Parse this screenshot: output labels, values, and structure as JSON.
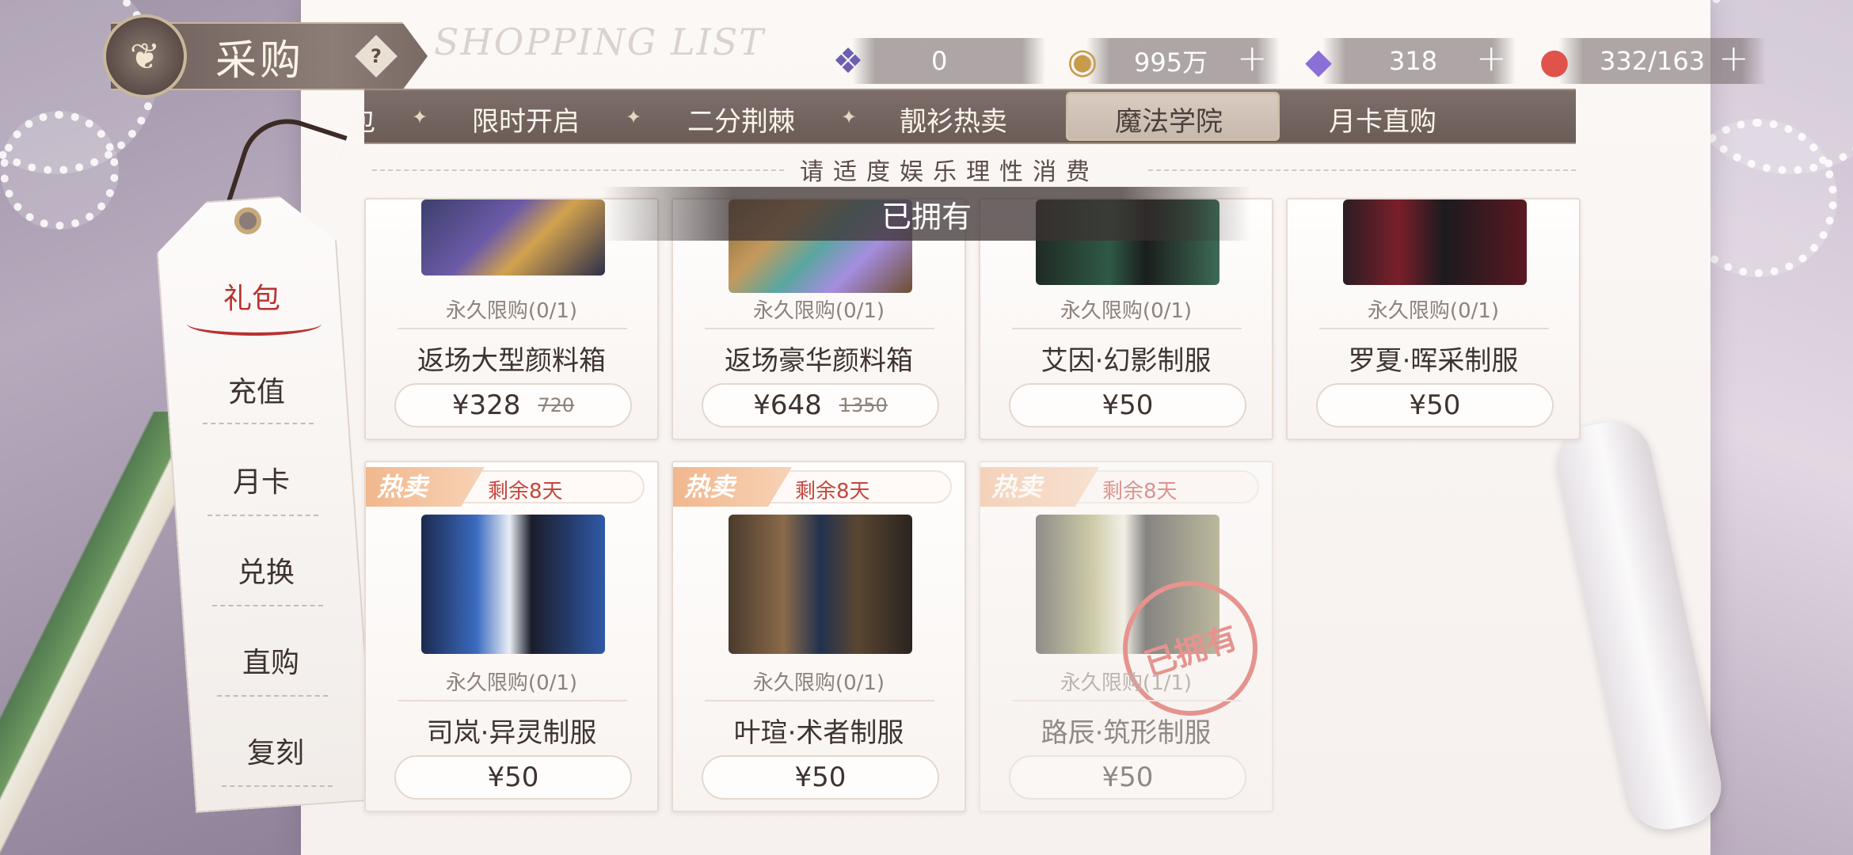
{
  "header": {
    "title": "采购",
    "help": "?",
    "watermark": "SHOPPING LIST"
  },
  "currencies": [
    {
      "icon": "ticket-icon",
      "value": "0"
    },
    {
      "icon": "coin-icon",
      "value": "995万"
    },
    {
      "icon": "diamond-icon",
      "value": "318"
    },
    {
      "icon": "cake-stamina-icon",
      "value": "332/163"
    }
  ],
  "plus_label": "+",
  "tabs": [
    {
      "label": "包",
      "active": false
    },
    {
      "label": "限时开启",
      "active": false
    },
    {
      "label": "二分荆棘",
      "active": false
    },
    {
      "label": "靓衫热卖",
      "active": false
    },
    {
      "label": "魔法学院",
      "active": true
    },
    {
      "label": "月卡直购",
      "active": false
    }
  ],
  "notice": "请适度娱乐理性消费",
  "owned_banner": "已拥有",
  "nav": [
    {
      "label": "礼包",
      "active": true
    },
    {
      "label": "充值",
      "active": false
    },
    {
      "label": "月卡",
      "active": false
    },
    {
      "label": "兑换",
      "active": false
    },
    {
      "label": "直购",
      "active": false
    },
    {
      "label": "复刻",
      "active": false
    }
  ],
  "cards": [
    {
      "limit": "永久限购(0/1)",
      "name": "返场大型颜料箱",
      "price": "¥328",
      "original": "720",
      "hot": false,
      "owned": false
    },
    {
      "limit": "永久限购(0/1)",
      "name": "返场豪华颜料箱",
      "price": "¥648",
      "original": "1350",
      "hot": false,
      "owned": false
    },
    {
      "limit": "永久限购(0/1)",
      "name": "艾因·幻影制服",
      "price": "¥50",
      "original": "",
      "hot": false,
      "owned": false
    },
    {
      "limit": "永久限购(0/1)",
      "name": "罗夏·晖采制服",
      "price": "¥50",
      "original": "",
      "hot": false,
      "owned": false
    },
    {
      "limit": "永久限购(0/1)",
      "name": "司岚·异灵制服",
      "price": "¥50",
      "original": "",
      "hot": true,
      "hot_label": "热卖",
      "remain": "剩余8天",
      "owned": false
    },
    {
      "limit": "永久限购(0/1)",
      "name": "叶瑄·术者制服",
      "price": "¥50",
      "original": "",
      "hot": true,
      "hot_label": "热卖",
      "remain": "剩余8天",
      "owned": false
    },
    {
      "limit": "永久限购(1/1)",
      "name": "路辰·筑形制服",
      "price": "¥50",
      "original": "",
      "hot": true,
      "hot_label": "热卖",
      "remain": "剩余8天",
      "owned": true,
      "stamp": "已拥有"
    }
  ],
  "colors": {
    "accent_red": "#b8322f",
    "hot_orange": "#f2b78d",
    "tab_bar": "#7d6e69"
  }
}
